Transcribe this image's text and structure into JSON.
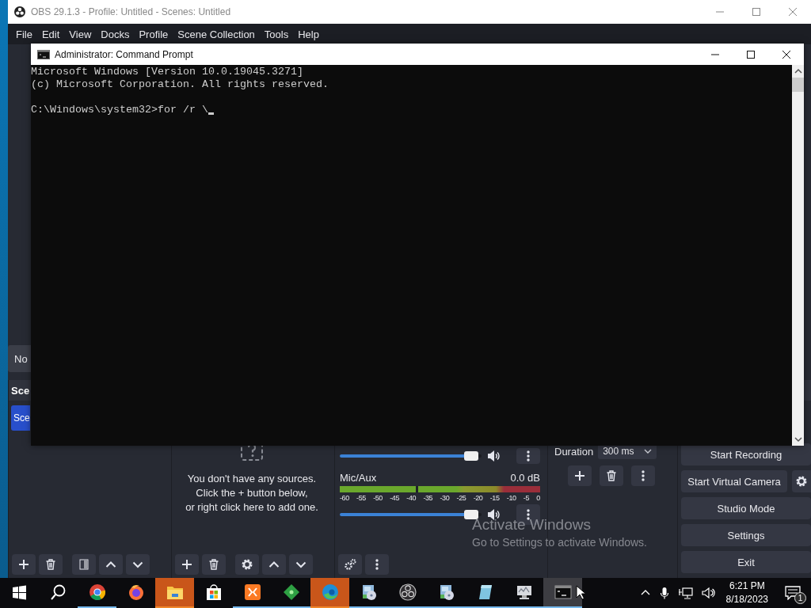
{
  "obs_window": {
    "title": "OBS 29.1.3 - Profile: Untitled - Scenes: Untitled"
  },
  "menu": [
    "File",
    "Edit",
    "View",
    "Docks",
    "Profile",
    "Scene Collection",
    "Tools",
    "Help"
  ],
  "preview": {
    "label": "No"
  },
  "scenes": {
    "title": "Sce",
    "items": [
      {
        "label": "Sce",
        "selected": true
      }
    ],
    "toolbar": [
      {
        "kind": "add"
      },
      {
        "kind": "remove"
      },
      {
        "kind": "filters"
      },
      {
        "kind": "up"
      },
      {
        "kind": "down"
      }
    ]
  },
  "sources": {
    "empty_lines": [
      "You don't have any sources.",
      "Click the + button below,",
      "or right click here to add one."
    ],
    "toolbar": [
      {
        "kind": "add"
      },
      {
        "kind": "remove"
      },
      {
        "kind": "properties"
      },
      {
        "kind": "up"
      },
      {
        "kind": "down"
      }
    ]
  },
  "mixer": {
    "channels": [
      {
        "level": 0.93,
        "muted": false
      },
      {
        "name": "Mic/Aux",
        "reading": "0.0 dB",
        "level": 0.93,
        "muted": false,
        "scale": [
          "-60",
          "-55",
          "-50",
          "-45",
          "-40",
          "-35",
          "-30",
          "-25",
          "-20",
          "-15",
          "-10",
          "-5",
          "0"
        ]
      }
    ],
    "toolbar": [
      {
        "kind": "advanced"
      },
      {
        "kind": "menu"
      }
    ]
  },
  "transitions": {
    "duration_label": "Duration",
    "duration_value": "300 ms",
    "toolbar": [
      {
        "kind": "add"
      },
      {
        "kind": "remove"
      },
      {
        "kind": "menu"
      }
    ]
  },
  "controls": [
    {
      "label": "Start Recording",
      "settings": false
    },
    {
      "label": "Start Virtual Camera",
      "settings": true
    },
    {
      "label": "Studio Mode",
      "settings": false
    },
    {
      "label": "Settings",
      "settings": false
    },
    {
      "label": "Exit",
      "settings": false
    }
  ],
  "activation_notice": {
    "title": "Activate Windows",
    "subtitle": "Go to Settings to activate Windows."
  },
  "cmd_window": {
    "title": "Administrator: Command Prompt",
    "blocks": [
      {
        "lines": [
          "Microsoft Windows [Version 10.0.19045.3271]",
          "(c) Microsoft Corporation. All rights reserved."
        ],
        "cursor": false
      },
      {
        "lines": [
          "C:\\Windows\\system32>for /r \\"
        ],
        "cursor": true
      }
    ]
  },
  "taskbar": {
    "apps": [
      {
        "kind": "start",
        "running": false,
        "highlighted": false,
        "selected": false
      },
      {
        "kind": "search",
        "running": false,
        "highlighted": false,
        "selected": false
      },
      {
        "kind": "chrome",
        "running": true,
        "highlighted": false,
        "selected": false
      },
      {
        "kind": "firefox",
        "running": false,
        "highlighted": false,
        "selected": false
      },
      {
        "kind": "folder",
        "running": true,
        "highlighted": true,
        "selected": false
      },
      {
        "kind": "store",
        "running": false,
        "highlighted": false,
        "selected": false
      },
      {
        "kind": "xampp",
        "running": true,
        "highlighted": false,
        "selected": false
      },
      {
        "kind": "diamond",
        "running": true,
        "highlighted": false,
        "selected": false
      },
      {
        "kind": "edge",
        "running": true,
        "highlighted": true,
        "selected": false
      },
      {
        "kind": "installer",
        "running": true,
        "highlighted": false,
        "selected": false
      },
      {
        "kind": "obs",
        "running": true,
        "highlighted": false,
        "selected": false
      },
      {
        "kind": "installer",
        "running": true,
        "highlighted": false,
        "selected": false
      },
      {
        "kind": "notepad",
        "running": true,
        "highlighted": false,
        "selected": false
      },
      {
        "kind": "monitor",
        "running": true,
        "highlighted": false,
        "selected": false
      },
      {
        "kind": "terminal",
        "running": true,
        "highlighted": false,
        "selected": true
      }
    ],
    "tray": [
      {
        "kind": "chevron"
      },
      {
        "kind": "microphone"
      },
      {
        "kind": "network"
      },
      {
        "kind": "volume"
      }
    ],
    "clock": {
      "time": "6:21 PM",
      "date": "8/18/2023"
    },
    "notifications": {
      "count": "1"
    }
  }
}
